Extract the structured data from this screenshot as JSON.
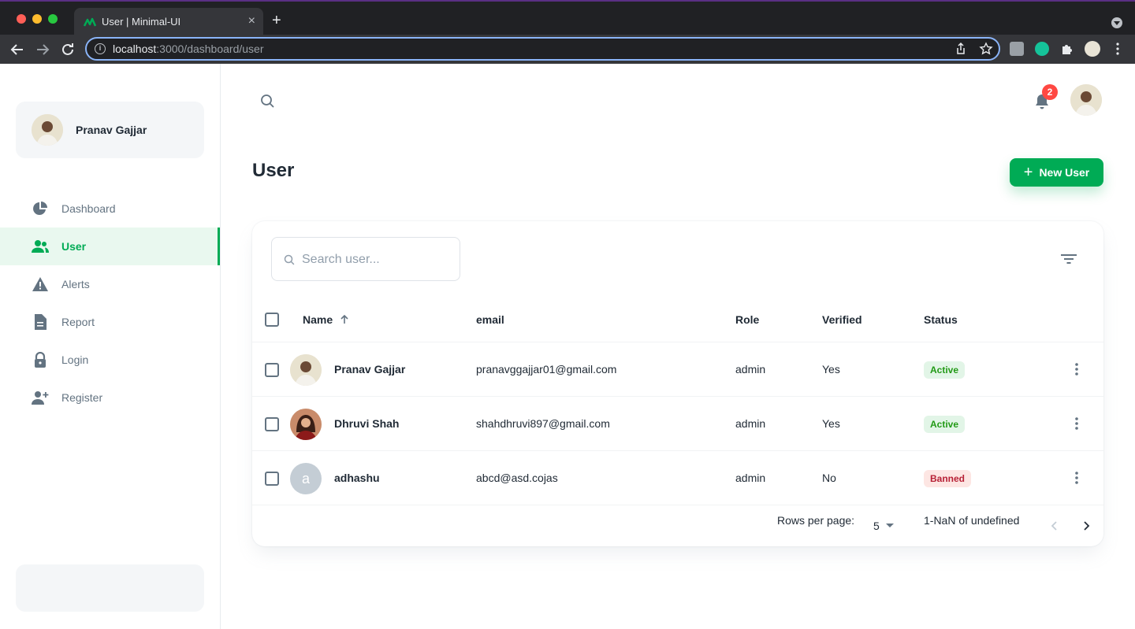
{
  "browser": {
    "tab_title": "User | Minimal-UI",
    "new_tab_label": "+",
    "close_label": "×",
    "url_host": "localhost",
    "url_path": ":3000/dashboard/user"
  },
  "sidebar": {
    "account_name": "Pranav Gajjar",
    "items": [
      {
        "label": "Dashboard",
        "icon": "pie-chart-icon"
      },
      {
        "label": "User",
        "icon": "people-icon",
        "active": true
      },
      {
        "label": "Alerts",
        "icon": "alert-triangle-icon"
      },
      {
        "label": "Report",
        "icon": "file-text-icon"
      },
      {
        "label": "Login",
        "icon": "lock-icon"
      },
      {
        "label": "Register",
        "icon": "person-add-icon"
      }
    ]
  },
  "header": {
    "notification_count": "2"
  },
  "page": {
    "title": "User",
    "new_user_label": "New User",
    "new_user_plus": "+"
  },
  "table": {
    "search_placeholder": "Search user...",
    "columns": [
      "Name",
      "email",
      "Role",
      "Verified",
      "Status"
    ],
    "rows": [
      {
        "name": "Pranav Gajjar",
        "email": "pranavggajjar01@gmail.com",
        "role": "admin",
        "verified": "Yes",
        "status": "Active",
        "avatar": "photo"
      },
      {
        "name": "Dhruvi Shah",
        "email": "shahdhruvi897@gmail.com",
        "role": "admin",
        "verified": "Yes",
        "status": "Active",
        "avatar": "photo"
      },
      {
        "name": "adhashu",
        "email": "abcd@asd.cojas",
        "role": "admin",
        "verified": "No",
        "status": "Banned",
        "avatar": "a"
      }
    ],
    "rows_per_page_label": "Rows per page:",
    "rows_per_page_value": "5",
    "range_label": "1-NaN of undefined"
  },
  "colors": {
    "primary": "#00ab55",
    "active_badge_bg": "#e2f5e7",
    "banned_badge_bg": "#fde6e3",
    "error": "#ff4842"
  }
}
